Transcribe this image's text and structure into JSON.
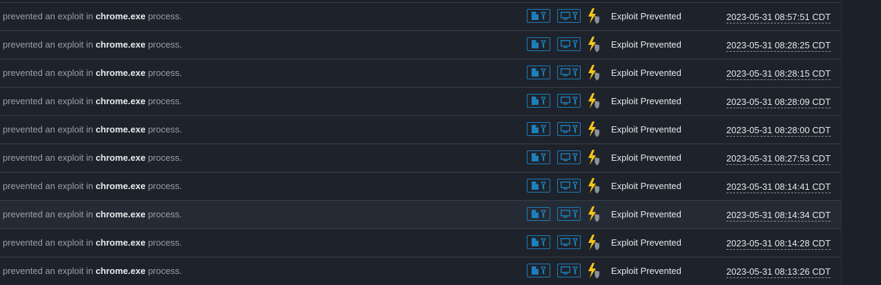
{
  "rows": [
    {
      "prefix": "prevented an exploit in",
      "process": "chrome.exe",
      "suffix": "process.",
      "status": "Exploit Prevented",
      "timestamp": "2023-05-31 08:57:51 CDT"
    },
    {
      "prefix": "prevented an exploit in",
      "process": "chrome.exe",
      "suffix": "process.",
      "status": "Exploit Prevented",
      "timestamp": "2023-05-31 08:28:25 CDT"
    },
    {
      "prefix": "prevented an exploit in",
      "process": "chrome.exe",
      "suffix": "process.",
      "status": "Exploit Prevented",
      "timestamp": "2023-05-31 08:28:15 CDT"
    },
    {
      "prefix": "prevented an exploit in",
      "process": "chrome.exe",
      "suffix": "process.",
      "status": "Exploit Prevented",
      "timestamp": "2023-05-31 08:28:09 CDT"
    },
    {
      "prefix": "prevented an exploit in",
      "process": "chrome.exe",
      "suffix": "process.",
      "status": "Exploit Prevented",
      "timestamp": "2023-05-31 08:28:00 CDT"
    },
    {
      "prefix": "prevented an exploit in",
      "process": "chrome.exe",
      "suffix": "process.",
      "status": "Exploit Prevented",
      "timestamp": "2023-05-31 08:27:53 CDT"
    },
    {
      "prefix": "prevented an exploit in",
      "process": "chrome.exe",
      "suffix": "process.",
      "status": "Exploit Prevented",
      "timestamp": "2023-05-31 08:14:41 CDT"
    },
    {
      "prefix": "prevented an exploit in",
      "process": "chrome.exe",
      "suffix": "process.",
      "status": "Exploit Prevented",
      "timestamp": "2023-05-31 08:14:34 CDT"
    },
    {
      "prefix": "prevented an exploit in",
      "process": "chrome.exe",
      "suffix": "process.",
      "status": "Exploit Prevented",
      "timestamp": "2023-05-31 08:14:28 CDT"
    },
    {
      "prefix": "prevented an exploit in",
      "process": "chrome.exe",
      "suffix": "process.",
      "status": "Exploit Prevented",
      "timestamp": "2023-05-31 08:13:26 CDT"
    }
  ],
  "icons": {
    "file_filter": "file-filter-icon",
    "device_filter": "monitor-filter-icon",
    "event_type": "exploit-prevented-bolt-shield-icon"
  },
  "colors": {
    "accent": "#1e7fbd",
    "bolt": "#f5c518",
    "shield": "#8d939b"
  },
  "highlighted_row": 7
}
